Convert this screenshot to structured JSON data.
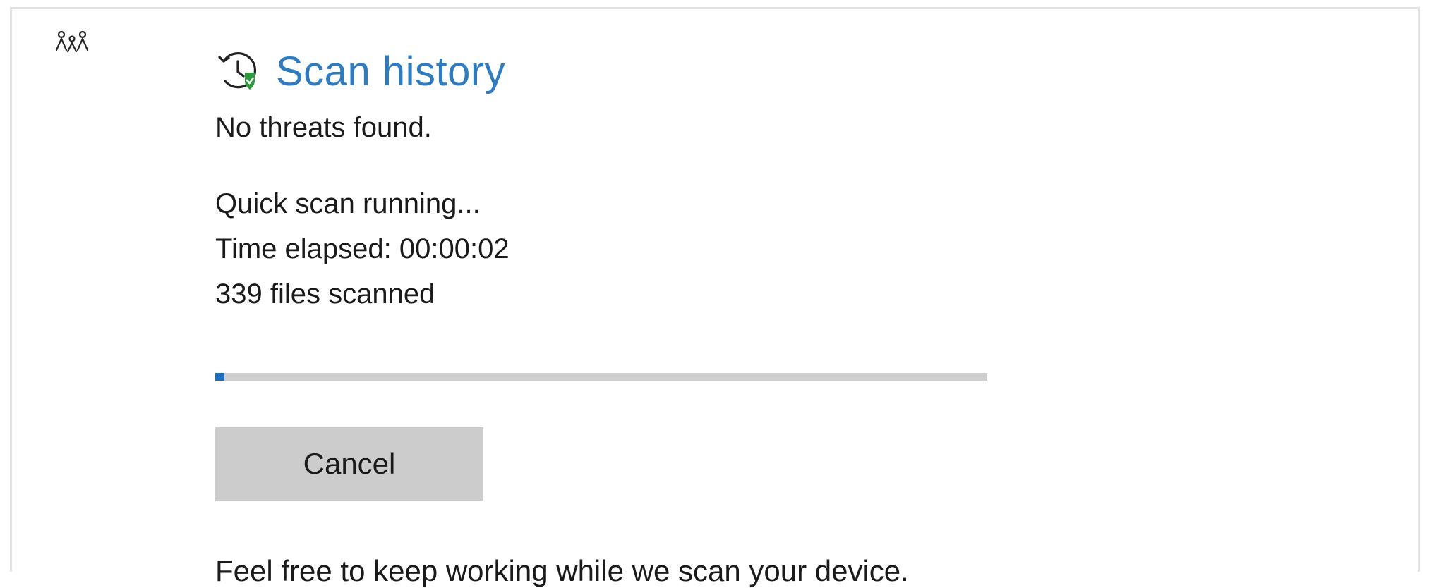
{
  "header": {
    "icon": "family-icon"
  },
  "scan": {
    "title": "Scan history",
    "title_icon": "history-shield-icon",
    "title_color": "#2f7bbf",
    "threat_status": "No threats found.",
    "running_text": "Quick scan running...",
    "elapsed_text": "Time elapsed: 00:00:02",
    "files_scanned_text": "339 files scanned",
    "progress_fraction": 0.012,
    "progress_color": "#1e6fbf",
    "cancel_label": "Cancel",
    "footer_note": "Feel free to keep working while we scan your device."
  }
}
